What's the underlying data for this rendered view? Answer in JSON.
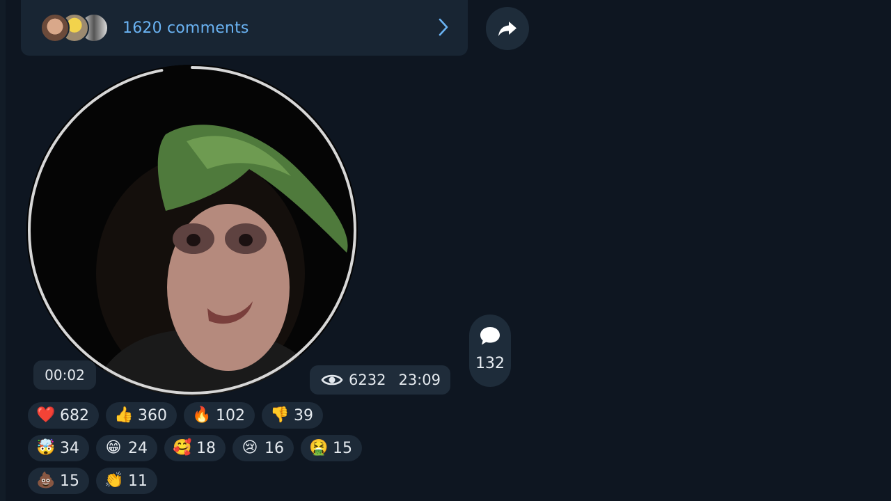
{
  "comments_bar": {
    "label": "1620 comments",
    "avatars": [
      "user-avatar-1",
      "user-avatar-2",
      "user-avatar-3"
    ]
  },
  "share": {
    "icon": "share-arrow-icon"
  },
  "video": {
    "duration": "00:02",
    "views": "6232",
    "time": "23:09",
    "progress_fraction": 0.97
  },
  "reply": {
    "icon": "comment-bubble-icon",
    "count": "132"
  },
  "reactions": [
    [
      {
        "emoji": "❤️",
        "count": "682"
      },
      {
        "emoji": "👍",
        "count": "360"
      },
      {
        "emoji": "🔥",
        "count": "102"
      },
      {
        "emoji": "👎",
        "count": "39"
      }
    ],
    [
      {
        "emoji": "🤯",
        "count": "34"
      },
      {
        "emoji": "😁",
        "count": "24"
      },
      {
        "emoji": "🥰",
        "count": "18"
      },
      {
        "emoji": "😢",
        "count": "16"
      },
      {
        "emoji": "🤮",
        "count": "15"
      }
    ],
    [
      {
        "emoji": "💩",
        "count": "15"
      },
      {
        "emoji": "👏",
        "count": "11"
      }
    ]
  ],
  "colors": {
    "background": "#0e1621",
    "panel": "#182533",
    "link": "#6ab3f3",
    "chip": "#1d2a38"
  }
}
